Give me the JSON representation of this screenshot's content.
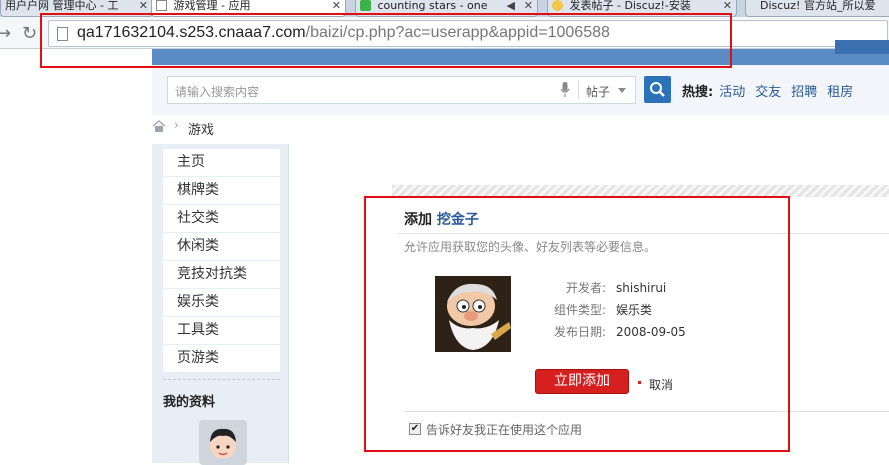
{
  "browser": {
    "tabs": [
      {
        "label": "用户户网 管理中心 - 工",
        "active": false
      },
      {
        "label": "游戏管理 - 应用",
        "active": true
      },
      {
        "label": "counting stars - one",
        "active": false
      },
      {
        "label": "发表帖子 - Discuz!-安装",
        "active": false
      },
      {
        "label": "Discuz! 官方站_所以爱",
        "active": false
      }
    ],
    "url_host": "qa171632104.s253.cnaaa7.com",
    "url_path": "/baizi/cp.php?ac=userapp&appid=1006588"
  },
  "header": {
    "search_placeholder": "请输入搜索内容",
    "search_scope": "帖子",
    "hot_label": "热搜:",
    "hot_links": [
      "活动",
      "交友",
      "招聘",
      "租房"
    ]
  },
  "breadcrumb": {
    "current": "游戏"
  },
  "sidebar": {
    "items": [
      "主页",
      "棋牌类",
      "社交类",
      "休闲类",
      "竞技对抗类",
      "娱乐类",
      "工具类",
      "页游类"
    ],
    "profile_title": "我的资料"
  },
  "dialog": {
    "title_prefix": "添加",
    "app_name": "挖金子",
    "description": "允许应用获取您的头像、好友列表等必要信息。",
    "fields": [
      {
        "key": "开发者:",
        "value": "shishirui"
      },
      {
        "key": "组件类型:",
        "value": "娱乐类"
      },
      {
        "key": "发布日期:",
        "value": "2008-09-05"
      }
    ],
    "add_button": "立即添加",
    "cancel_link": "取消",
    "notify_checkbox": "告诉好友我正在使用这个应用",
    "notify_checked": true
  },
  "colors": {
    "accent_red": "#d6201f",
    "link_blue": "#2a5a9a",
    "annotation_red": "#e01010"
  }
}
